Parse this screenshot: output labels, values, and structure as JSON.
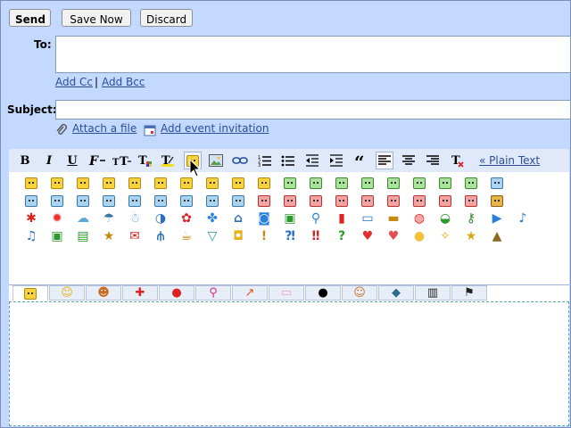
{
  "toolbar": {
    "send": "Send",
    "save_now": "Save Now",
    "discard": "Discard"
  },
  "compose": {
    "to_label": "To:",
    "to_value": "",
    "add_cc": "Add Cc",
    "separator": "|",
    "add_bcc": "Add Bcc",
    "subject_label": "Subject:",
    "subject_value": "",
    "attach_file": "Attach a file",
    "add_event": "Add event invitation"
  },
  "format_toolbar": {
    "bold": "B",
    "italic": "I",
    "underline": "U",
    "plain_text": "« Plain Text"
  },
  "emoticons": {
    "rows": [
      [
        "yellow",
        "yellow",
        "yellow",
        "yellow",
        "yellow",
        "yellow",
        "yellow",
        "yellow",
        "yellow",
        "yellow",
        "green",
        "green",
        "green",
        "green",
        "green",
        "green",
        "green",
        "green",
        "blue"
      ],
      [
        "blue",
        "blue",
        "blue",
        "blue",
        "blue",
        "blue",
        "blue",
        "blue",
        "blue",
        "red",
        "red",
        "red",
        "red",
        "red",
        "red",
        "red",
        "red",
        "red",
        "orange"
      ],
      [
        "crab",
        "sun",
        "cloud",
        "umbrella",
        "snowman",
        "moon",
        "flower",
        "clover",
        "house",
        "camera",
        "gift",
        "magnifier",
        "phone",
        "computer",
        "briefcase",
        "ball",
        "car",
        "key",
        "film",
        "music"
      ],
      [
        "note",
        "tv",
        "radio",
        "star-house",
        "envelope",
        "fork",
        "coffee",
        "cocktail",
        "mug",
        "exclamation",
        "question-exclaim",
        "double-exclaim",
        "question",
        "heart",
        "broken-heart",
        "bulb",
        "sparkle",
        "star",
        "poop"
      ]
    ],
    "tabs": [
      "yellow-face",
      "smile",
      "laugh",
      "first-aid",
      "strawberry",
      "bicycle",
      "arrow",
      "pink-face",
      "black-circle",
      "monkey",
      "cat",
      "clapper",
      "flag"
    ]
  },
  "colors": {
    "bg": "#c3d9ff",
    "link": "#2a4e9a",
    "toolbar": "#dfe9f9"
  }
}
